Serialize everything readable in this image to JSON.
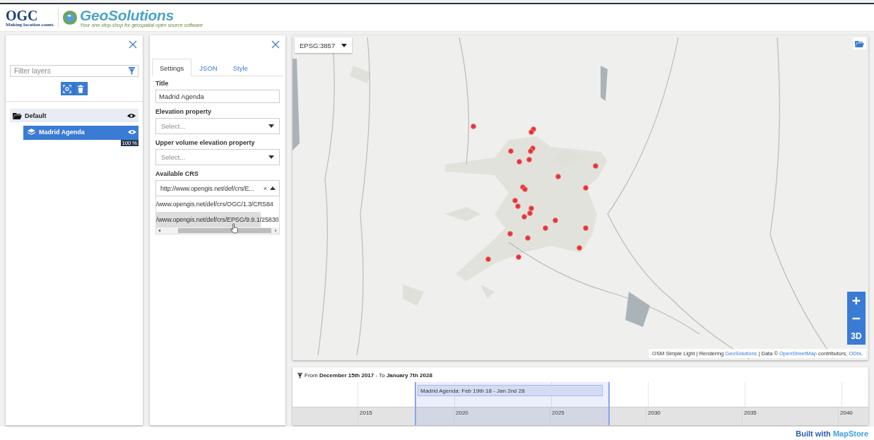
{
  "header": {
    "ogc_logo": "OGC",
    "ogc_tagline": "Making location count.",
    "brand": "GeoSolutions",
    "brand_tagline": "Your one-stop-shop for geospatial open source software"
  },
  "layers_panel": {
    "filter": {
      "placeholder": "Filter layers"
    },
    "groups": [
      {
        "name": "Default",
        "visible": true,
        "children": [
          {
            "name": "Madrid Agenda",
            "selected": true,
            "visible": true,
            "opacity": "100 %",
            "level": 1
          }
        ]
      }
    ]
  },
  "settings_panel": {
    "tabs": [
      {
        "label": "Settings",
        "selected": true
      },
      {
        "label": "JSON",
        "selected": false
      },
      {
        "label": "Style",
        "selected": false
      }
    ],
    "fields": [
      {
        "kind": "text",
        "label": "Title",
        "value": "Madrid Agenda"
      },
      {
        "kind": "select",
        "label": "Elevation property",
        "placeholder": "Select..."
      },
      {
        "kind": "select",
        "label": "Upper volume elevation property",
        "placeholder": "Select..."
      },
      {
        "kind": "multiselect",
        "label": "Available CRS",
        "value": "http://www.opengis.net/def/crs/E...",
        "clear": "×",
        "options": [
          {
            "label": "/www.opengis.net/def/crs/OGC/1.3/CRS84",
            "selected": false
          },
          {
            "label": "/www.opengis.net/def/crs/EPSG/9.9.1/25830",
            "selected": true
          }
        ]
      }
    ]
  },
  "map": {
    "crs": "EPSG:3857",
    "zoom_buttons": [
      "+",
      "−",
      "3D"
    ],
    "attribution": [
      {
        "text": "OSM Simple Light | Rendering ",
        "link": false
      },
      {
        "text": "GeoSolutions",
        "link": true
      },
      {
        "text": " | Data © ",
        "link": false
      },
      {
        "text": "OpenStreetMap",
        "link": true
      },
      {
        "text": " contributors, ",
        "link": false
      },
      {
        "text": "ODbL",
        "link": true
      }
    ]
  },
  "timeline": {
    "filter": "From **December 15th 2017** - To **January 7th 2028**",
    "item": "Madrid Agenda: Feb 19th 18 - Jan 2nd 28",
    "years": [
      "2015",
      "2020",
      "2025",
      "2030",
      "2035",
      "2040"
    ]
  },
  "footer": {
    "prefix": "Built with",
    "brand": "MapStore"
  }
}
